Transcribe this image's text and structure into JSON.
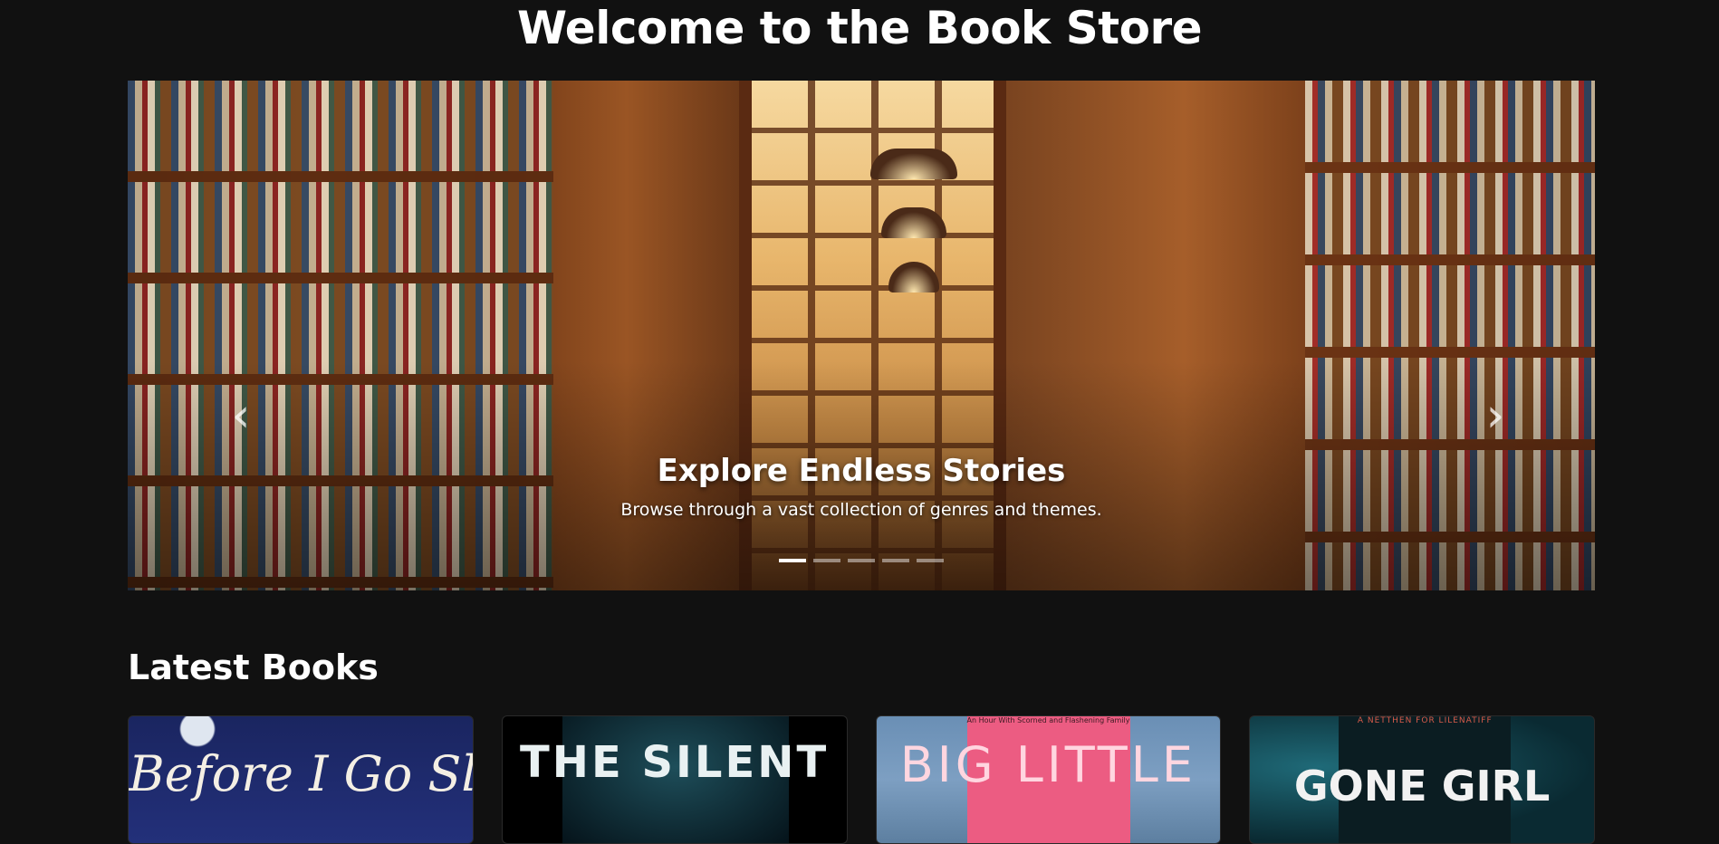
{
  "page": {
    "title": "Welcome to the Book Store"
  },
  "carousel": {
    "prev_icon": "chevron-left-icon",
    "next_icon": "chevron-right-icon",
    "slide": {
      "title": "Explore Endless Stories",
      "text": "Browse through a vast collection of genres and themes."
    },
    "indicator_count": 5,
    "active_index": 0
  },
  "latest": {
    "title": "Latest Books",
    "books": [
      {
        "cover_text": "Before I Go Sleep",
        "tagline": ""
      },
      {
        "cover_text": "THE SILENT",
        "tagline": ""
      },
      {
        "cover_text": "BIG LITTLE",
        "tagline": "An Hour With Scorned and Flashening Family"
      },
      {
        "cover_text": "GONE GIRL",
        "tagline": "A NETTHEN FOR LILENATIFF"
      }
    ]
  },
  "colors": {
    "background": "#111111",
    "text": "#ffffff"
  }
}
